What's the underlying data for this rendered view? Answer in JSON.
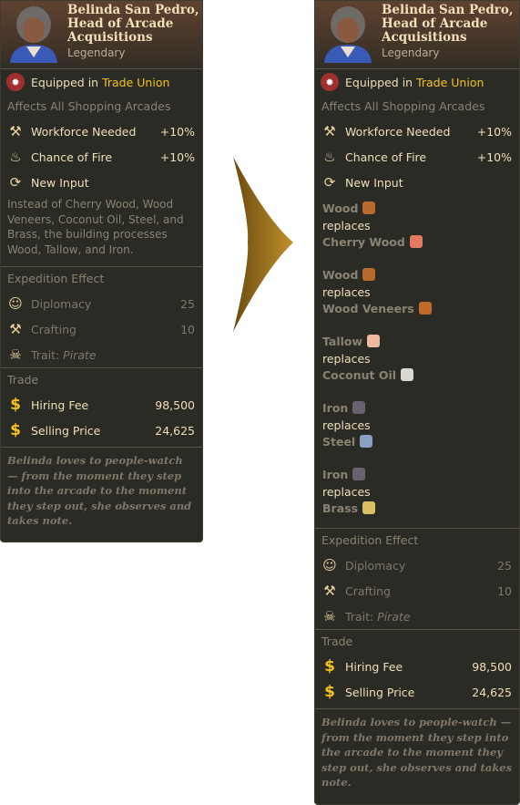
{
  "card": {
    "name": "Belinda San Pedro, Head of Arcade Acquisitions",
    "rarity": "Legendary",
    "equipped_prefix": "Equipped in",
    "equipped_building": "Trade Union",
    "affects": "Affects All Shopping Arcades",
    "effects": [
      {
        "icon": "hammer-wrench-icon",
        "label": "Workforce Needed",
        "value": "+10%"
      },
      {
        "icon": "fire-icon",
        "label": "Chance of Fire",
        "value": "+10%"
      },
      {
        "icon": "cycle-arrows-icon",
        "label": "New Input",
        "value": ""
      }
    ],
    "description": "Instead of Cherry Wood, Wood Veneers, Coconut Oil, Steel, and Brass, the building processes Wood, Tallow, and Iron.",
    "expedition": {
      "title": "Expedition Effect",
      "items": [
        {
          "icon": "speech-bubble-icon",
          "label": "Diplomacy",
          "value": "25"
        },
        {
          "icon": "crossed-tools-icon",
          "label": "Crafting",
          "value": "10"
        },
        {
          "icon": "skull-crossbones-icon",
          "label": "Trait:",
          "trait": "Pirate"
        }
      ]
    },
    "trade": {
      "title": "Trade",
      "items": [
        {
          "icon": "dollar-icon",
          "label": "Hiring Fee",
          "value": "98,500"
        },
        {
          "icon": "dollar-icon",
          "label": "Selling Price",
          "value": "24,625"
        }
      ]
    },
    "flavor": "Belinda loves to people-watch — from the moment they step into the arcade to the moment they step out, she observes and takes note.",
    "replacements": [
      {
        "new": "Wood",
        "new_color": "#b8692e",
        "word": "replaces",
        "old": "Cherry Wood",
        "old_color": "#e07a60"
      },
      {
        "new": "Wood",
        "new_color": "#b8692e",
        "word": "replaces",
        "old": "Wood Veneers",
        "old_color": "#c06a2a"
      },
      {
        "new": "Tallow",
        "new_color": "#f0b8a0",
        "word": "replaces",
        "old": "Coconut Oil",
        "old_color": "#d8d8d0"
      },
      {
        "new": "Iron",
        "new_color": "#6a6070",
        "word": "replaces",
        "old": "Steel",
        "old_color": "#8aa0c0"
      },
      {
        "new": "Iron",
        "new_color": "#6a6070",
        "word": "replaces",
        "old": "Brass",
        "old_color": "#d8c060"
      }
    ]
  },
  "colors": {
    "accent": "#f6c21a",
    "text": "#f0dfb8",
    "muted": "#8a8270",
    "panel": "#2b2b26"
  }
}
